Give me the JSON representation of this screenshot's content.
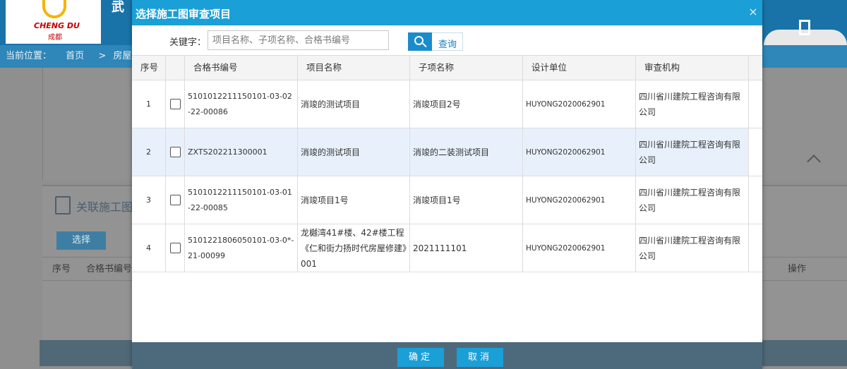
{
  "background": {
    "logo_text_en": "CHENG DU",
    "logo_text_cn": "成都",
    "header_text": "武",
    "breadcrumb": {
      "label": "当前位置：",
      "home": "首页",
      "separator": ">",
      "current": "房屋建筑"
    },
    "section_title": "关联施工图",
    "select_button": "选择",
    "table_headers": [
      "序号",
      "合格书编号",
      "操作"
    ]
  },
  "modal": {
    "title": "选择施工图审查项目",
    "close_glyph": "×",
    "search": {
      "label": "关键字：",
      "placeholder": "项目名称、子项名称、合格书编号",
      "value": "",
      "button_label": "查询"
    },
    "columns": [
      "序号",
      "合格书编号",
      "项目名称",
      "子项名称",
      "设计单位",
      "审查机构"
    ],
    "rows": [
      {
        "no": "1",
        "cert": "5101012211150101-03-02-22-00086",
        "project": "消竣的测试项目",
        "subitem": "消竣项目2号",
        "designer": "HUYONG2020062901",
        "reviewer": "四川省川建院工程咨询有限公司",
        "highlighted": false
      },
      {
        "no": "2",
        "cert": "ZXTS202211300001",
        "project": "消竣的测试项目",
        "subitem": "消竣的二装测试项目",
        "designer": "HUYONG2020062901",
        "reviewer": "四川省川建院工程咨询有限公司",
        "highlighted": true
      },
      {
        "no": "3",
        "cert": "5101012211150101-03-01-22-00085",
        "project": "消竣项目1号",
        "subitem": "消竣项目1号",
        "designer": "HUYONG2020062901",
        "reviewer": "四川省川建院工程咨询有限公司",
        "highlighted": false
      },
      {
        "no": "4",
        "cert": "5101221806050101-03-0*-21-00099",
        "project": "龙樾湾41#楼、42#楼工程《仁和街力扬时代房屋修建》001",
        "subitem": "2021111101",
        "designer": "HUYONG2020062901",
        "reviewer": "四川省川建院工程咨询有限公司",
        "highlighted": false
      }
    ],
    "footer": {
      "confirm": "确定",
      "cancel": "取消"
    }
  },
  "colors": {
    "title_bar": "#1a9fd6",
    "button": "#1a9fd6",
    "row_highlight": "#e8f1fb",
    "footer": "#4d6a7c"
  }
}
